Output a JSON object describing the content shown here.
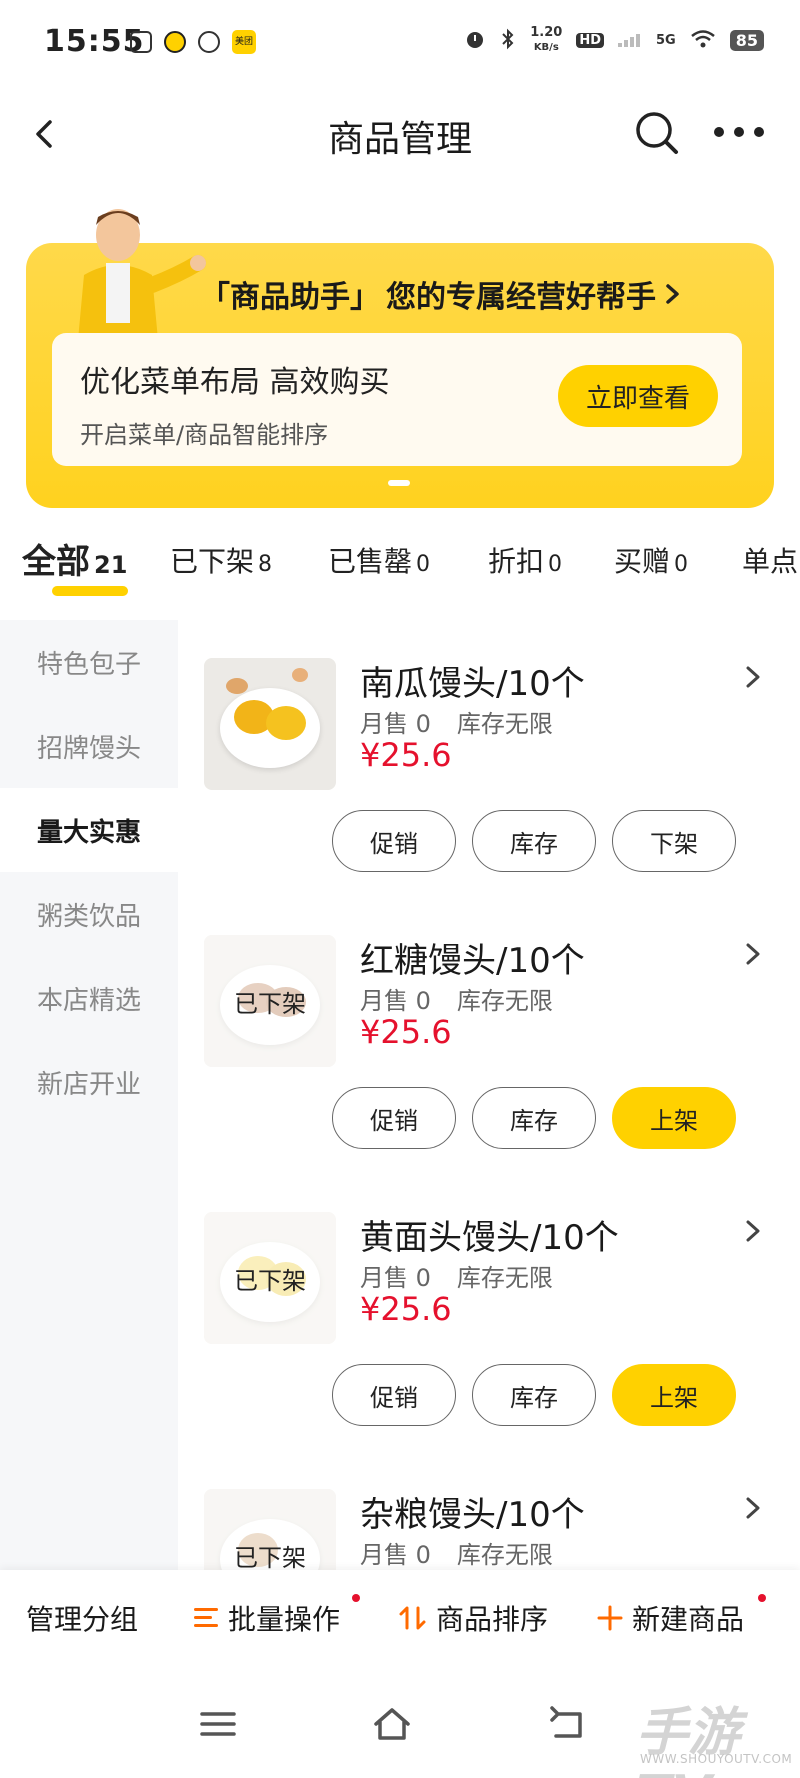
{
  "status_bar": {
    "time": "15:55",
    "net_speed_value": "1.20",
    "net_speed_unit": "KB/s",
    "hd": "HD",
    "network": "5G",
    "battery": "85",
    "meituan_icon_text": "美团"
  },
  "header": {
    "title": "商品管理"
  },
  "banner": {
    "headline_brand": "「商品助手」",
    "headline_text": "您的专属经营好帮手",
    "card_title": "优化菜单布局 高效购买",
    "card_subtitle": "开启菜单/商品智能排序",
    "card_button": "立即查看"
  },
  "tabs": [
    {
      "label": "全部",
      "count": "21"
    },
    {
      "label": "已下架",
      "count": "8"
    },
    {
      "label": "已售罄",
      "count": "0"
    },
    {
      "label": "折扣",
      "count": "0"
    },
    {
      "label": "买赠",
      "count": "0"
    },
    {
      "label": "单点",
      "count": ""
    }
  ],
  "categories": [
    {
      "label": "特色包子"
    },
    {
      "label": "招牌馒头"
    },
    {
      "label": "量大实惠"
    },
    {
      "label": "粥类饮品"
    },
    {
      "label": "本店精选"
    },
    {
      "label": "新店开业"
    }
  ],
  "products": [
    {
      "name": "南瓜馒头/10个",
      "monthly_sales": "月售 0",
      "stock": "库存无限",
      "price": "¥25.6",
      "off_shelf_label": "",
      "btn_promo": "促销",
      "btn_stock": "库存",
      "btn_shelf": "下架"
    },
    {
      "name": "红糖馒头/10个",
      "monthly_sales": "月售 0",
      "stock": "库存无限",
      "price": "¥25.6",
      "off_shelf_label": "已下架",
      "btn_promo": "促销",
      "btn_stock": "库存",
      "btn_shelf": "上架"
    },
    {
      "name": "黄面头馒头/10个",
      "monthly_sales": "月售 0",
      "stock": "库存无限",
      "price": "¥25.6",
      "off_shelf_label": "已下架",
      "btn_promo": "促销",
      "btn_stock": "库存",
      "btn_shelf": "上架"
    },
    {
      "name": "杂粮馒头/10个",
      "monthly_sales": "月售 0",
      "stock": "库存无限",
      "price": "",
      "off_shelf_label": "已下架",
      "btn_promo": "",
      "btn_stock": "",
      "btn_shelf": ""
    }
  ],
  "action_bar": {
    "manage_groups": "管理分组",
    "batch_ops": "批量操作",
    "sort_products": "商品排序",
    "new_product": "新建商品"
  },
  "watermark": {
    "text": "手游TV",
    "url": "WWW.SHOUYOUTV.COM"
  },
  "colors": {
    "accent": "#ffd100",
    "price": "#e5112d",
    "action_icon": "#ff6a00"
  }
}
